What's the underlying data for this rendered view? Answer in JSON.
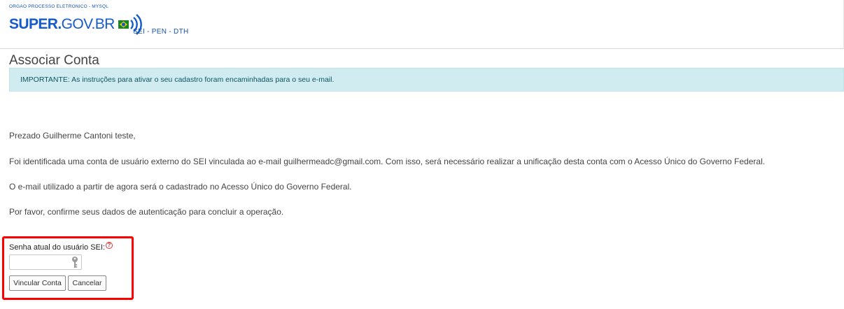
{
  "header": {
    "org_label": "ORGAO PROCESSO ELETRONICO - MYSQL",
    "logo_text_super": "SUPER.",
    "logo_text_gov": "GOV.BR",
    "subsystems": "SEI - PEN - DTH",
    "brand_colors": {
      "blue": "#155bcb",
      "green": "#168821",
      "yellow": "#ffcd07"
    }
  },
  "page": {
    "title": "Associar Conta",
    "alert": "IMPORTANTE: As instruções para ativar o seu cadastro foram encaminhadas para o seu e-mail.",
    "greeting": "Prezado Guilherme Cantoni teste,",
    "paragraph_1": "Foi identificada uma conta de usuário externo do SEI vinculada ao e-mail guilhermeadc@gmail.com. Com isso, será necessário realizar a unificação desta conta com o Acesso Único do Governo Federal.",
    "paragraph_2": "O e-mail utilizado a partir de agora será o cadastrado no Acesso Único do Governo Federal.",
    "paragraph_3": "Por favor, confirme seus dados de autenticação para concluir a operação."
  },
  "form": {
    "password_label": "Senha atual do usuário SEI:",
    "help_icon": "help-icon",
    "password_value": "",
    "submit_label": "Vincular Conta",
    "cancel_label": "Cancelar",
    "highlight_color": "#ff0000"
  }
}
